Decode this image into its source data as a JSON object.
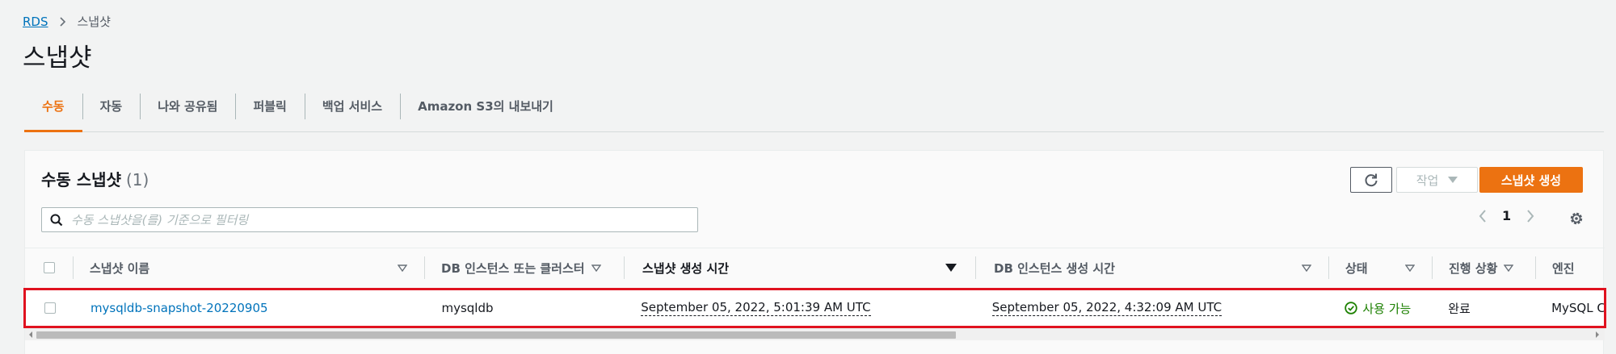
{
  "breadcrumb": {
    "root": "RDS",
    "current": "스냅샷"
  },
  "page": {
    "title": "스냅샷"
  },
  "tabs": [
    {
      "label": "수동",
      "active": true
    },
    {
      "label": "자동"
    },
    {
      "label": "나와 공유됨"
    },
    {
      "label": "퍼블릭"
    },
    {
      "label": "백업 서비스"
    },
    {
      "label": "Amazon S3의 내보내기"
    }
  ],
  "panel": {
    "title": "수동 스냅샷",
    "count": "(1)",
    "actions_label": "작업",
    "create_label": "스냅샷 생성",
    "search_placeholder": "수동 스냅샷을(를) 기준으로 필터링",
    "page_number": "1"
  },
  "table": {
    "columns": [
      "스냅샷 이름",
      "DB 인스턴스 또는 클러스터",
      "스냅샷 생성 시간",
      "DB 인스턴스 생성 시간",
      "상태",
      "진행 상황",
      "엔진"
    ],
    "rows": [
      {
        "name": "mysqldb-snapshot-20220905",
        "instance": "mysqldb",
        "snapshot_time": "September 05, 2022, 5:01:39 AM UTC",
        "instance_time": "September 05, 2022, 4:32:09 AM UTC",
        "status": "사용 가능",
        "progress": "완료",
        "engine": "MySQL Co"
      }
    ]
  },
  "colors": {
    "accent": "#ec7211",
    "link": "#0073bb",
    "success": "#1d8102",
    "highlight": "#e0121f"
  }
}
